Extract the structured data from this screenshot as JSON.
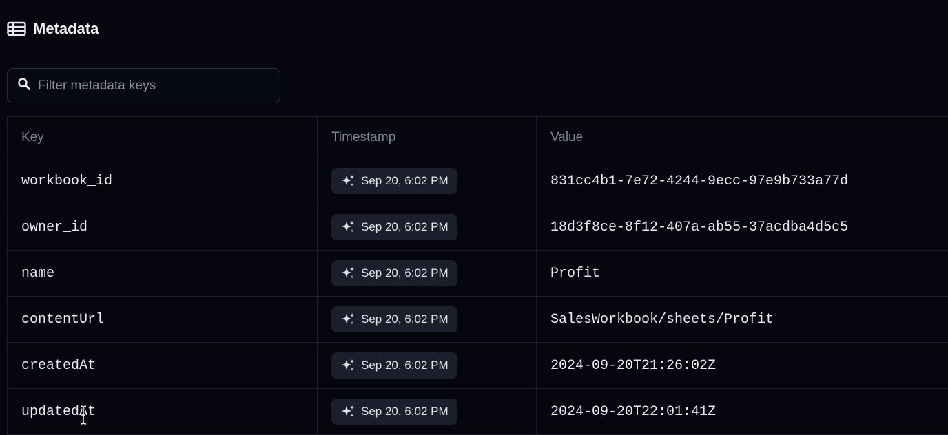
{
  "header": {
    "title": "Metadata",
    "icon": "table-icon"
  },
  "search": {
    "placeholder": "Filter metadata keys",
    "value": ""
  },
  "table": {
    "columns": [
      "Key",
      "Timestamp",
      "Value"
    ],
    "rows": [
      {
        "key": "workbook_id",
        "timestamp": "Sep 20, 6:02 PM",
        "value": "831cc4b1-7e72-4244-9ecc-97e9b733a77d"
      },
      {
        "key": "owner_id",
        "timestamp": "Sep 20, 6:02 PM",
        "value": "18d3f8ce-8f12-407a-ab55-37acdba4d5c5"
      },
      {
        "key": "name",
        "timestamp": "Sep 20, 6:02 PM",
        "value": "Profit"
      },
      {
        "key": "contentUrl",
        "timestamp": "Sep 20, 6:02 PM",
        "value": "SalesWorkbook/sheets/Profit"
      },
      {
        "key": "createdAt",
        "timestamp": "Sep 20, 6:02 PM",
        "value": "2024-09-20T21:26:02Z"
      },
      {
        "key": "updatedAt",
        "timestamp": "Sep 20, 6:02 PM",
        "value": "2024-09-20T22:01:41Z"
      }
    ]
  },
  "icons": {
    "search": "search-icon",
    "timestamp": "sparkle-icon",
    "cursor": "text-cursor-icon"
  },
  "colors": {
    "background": "#05060e",
    "chip": "#1b1f2b",
    "border": "#1c1f2b"
  }
}
